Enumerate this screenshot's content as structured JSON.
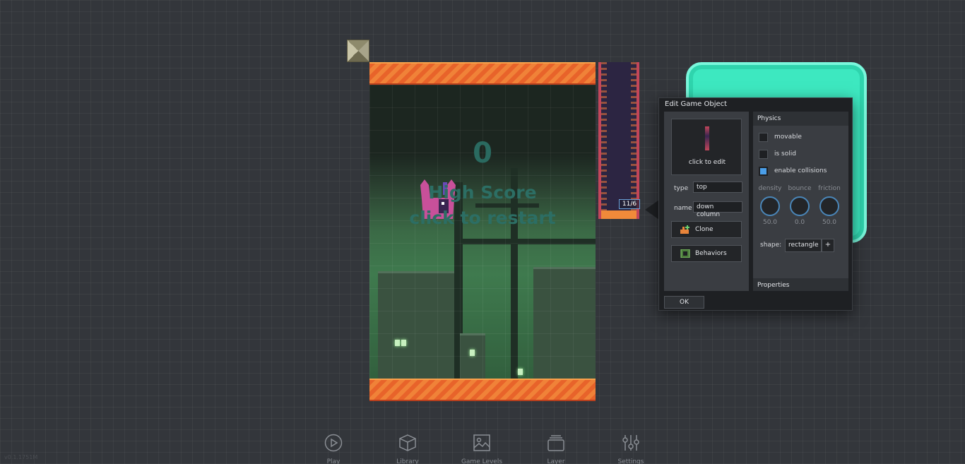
{
  "game": {
    "score": "0",
    "high_score_text": "High Score",
    "restart_text": "click to restart"
  },
  "selection": {
    "label": "11/6"
  },
  "dialog": {
    "title": "Edit Game Object",
    "preview_label": "click to edit",
    "type_label": "type",
    "type_value": "top",
    "name_label": "name",
    "name_value": "down column",
    "clone_label": "Clone",
    "behaviors_label": "Behaviors",
    "ok_label": "OK",
    "physics": {
      "header": "Physics",
      "movable_label": "movable",
      "movable": false,
      "solid_label": "is solid",
      "solid": false,
      "collisions_label": "enable collisions",
      "collisions": true,
      "density_label": "density",
      "density_value": "50.0",
      "bounce_label": "bounce",
      "bounce_value": "0.0",
      "friction_label": "friction",
      "friction_value": "50.0",
      "shape_label": "shape:",
      "shape_value": "rectangle",
      "shape_add": "+"
    },
    "properties_header": "Properties"
  },
  "toolbar": {
    "play": "Play",
    "library": "Library",
    "game_levels": "Game Levels",
    "layer": "Layer",
    "settings": "Settings"
  },
  "version": "v0.1.1751M",
  "colors": {
    "accent_blue": "#4a9ee8",
    "band_orange": "#e8632a",
    "cyan_object": "#3de8c0"
  }
}
